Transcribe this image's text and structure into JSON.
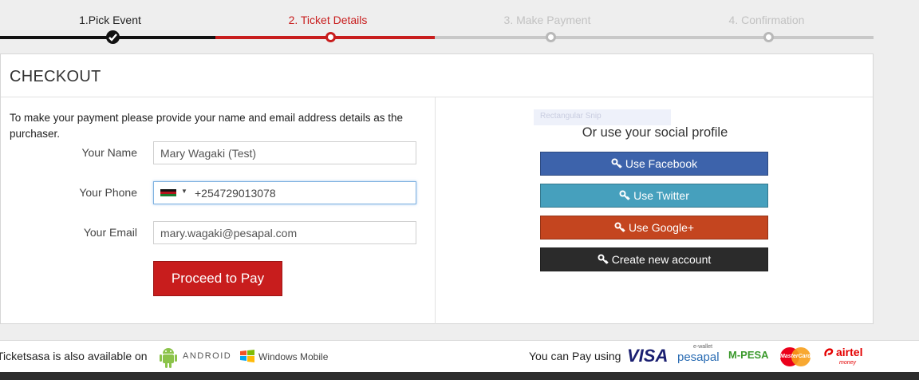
{
  "steps": [
    {
      "label": "1.Pick Event",
      "state": "done"
    },
    {
      "label": "2. Ticket Details",
      "state": "active"
    },
    {
      "label": "3. Make Payment",
      "state": "todo"
    },
    {
      "label": "4. Confirmation",
      "state": "todo"
    }
  ],
  "colors": {
    "accent": "#c81d1d",
    "facebook": "#3d63ab",
    "twitter": "#46a0bd",
    "google": "#c4451f",
    "dark": "#2b2b2b"
  },
  "checkout": {
    "title": "CHECKOUT",
    "intro": "To make your payment please provide your name and email address details as the purchaser.",
    "name_label": "Your Name",
    "name_value": "Mary Wagaki (Test)",
    "phone_label": "Your Phone",
    "phone_value": "+254729013078",
    "email_label": "Your Email",
    "email_value": "mary.wagaki@pesapal.com",
    "proceed_label": "Proceed to Pay"
  },
  "social": {
    "snip_label": "Rectangular Snip",
    "title": "Or use your social profile",
    "facebook": "Use Facebook",
    "twitter": "Use Twitter",
    "google": "Use Google+",
    "new_account": "Create new account"
  },
  "footer": {
    "available_text": "Ticketsasa is also available on",
    "android": "ANDROID",
    "windows": "Windows Mobile",
    "pay_text": "You can Pay using",
    "visa": "VISA",
    "pesapal_tag": "e-wallet",
    "pesapal": "pesapal",
    "mpesa": "M-PESA",
    "mastercard": "MasterCard",
    "airtel": "airtel",
    "airtel_sub": "money"
  }
}
